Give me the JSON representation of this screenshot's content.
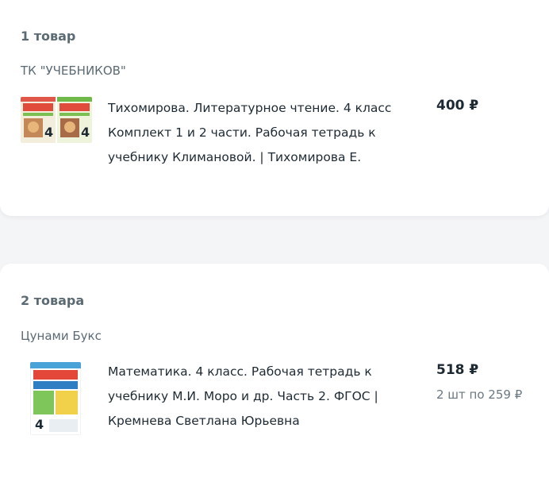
{
  "orders": [
    {
      "count_label": "1 товар",
      "seller": "ТК \"УЧЕБНИКОВ\"",
      "item": {
        "title": "Тихомирова. Литературное чтение. 4 класс Комплект 1 и 2 части. Рабочая тетрадь к учебнику Климановой. | Тихомирова Е.",
        "price": "400 ₽",
        "cover_icon": "book-cover-literature-workbooks"
      }
    },
    {
      "count_label": "2 товара",
      "seller": "Цунами Букс",
      "item": {
        "title": "Математика. 4 класс. Рабочая тетрадь к учебнику М.И. Моро и др. Часть 2. ФГОС | Кремнева Светлана Юрьевна",
        "price": "518 ₽",
        "unit_price": "2 шт по 259 ₽",
        "cover_icon": "book-cover-math-workbook"
      }
    }
  ],
  "colors": {
    "background": "#f4f5f7",
    "card": "#ffffff",
    "text_primary": "#1e2a33",
    "text_secondary": "#5b6a73"
  }
}
